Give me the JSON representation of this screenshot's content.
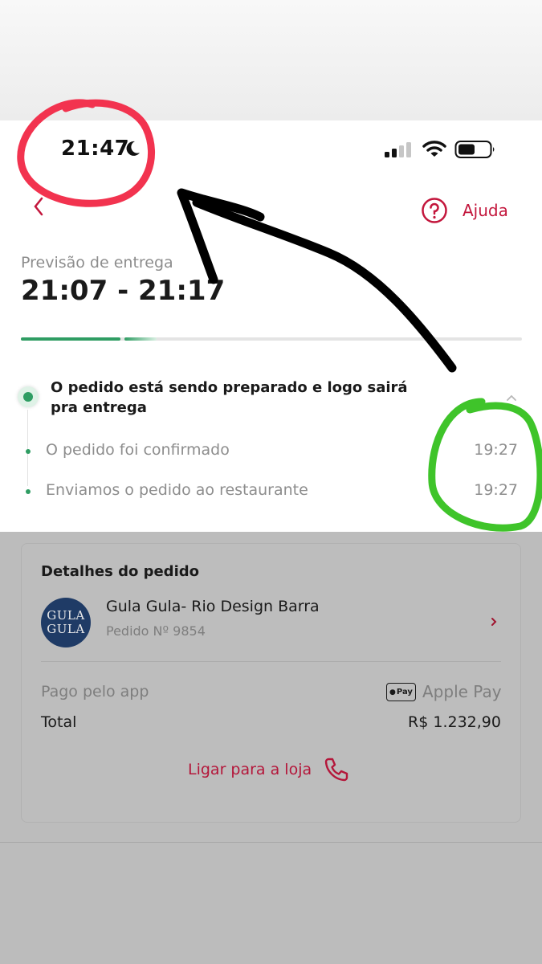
{
  "status_bar": {
    "time": "21:47",
    "icons": [
      "moon-icon",
      "signal-icon",
      "wifi-icon",
      "battery-icon"
    ]
  },
  "header": {
    "back_icon": "chevron-left-icon",
    "help_label": "Ajuda",
    "help_icon": "question-circle-icon"
  },
  "delivery": {
    "eta_label": "Previsão de entrega",
    "eta_range": "21:07 - 21:17",
    "progress_segments_complete": 1,
    "progress_segments_in_progress": 1
  },
  "timeline": {
    "current": "O pedido está sendo preparado e logo sairá pra entrega",
    "steps": [
      {
        "label": "O pedido foi confirmado",
        "time": "19:27"
      },
      {
        "label": "Enviamos o pedido ao restaurante",
        "time": "19:27"
      }
    ]
  },
  "order_details": {
    "title": "Detalhes do pedido",
    "store_logo_line1": "GULA",
    "store_logo_line2": "GULA",
    "store_name": "Gula Gula- Rio Design Barra",
    "order_number": "Pedido Nº 9854",
    "paid_label": "Pago pelo app",
    "applepay_badge": "Pay",
    "paid_method": "Apple Pay",
    "total_label": "Total",
    "total_value": "R$ 1.232,90",
    "call_label": "Ligar para a loja"
  },
  "colors": {
    "accent_red": "#c3163c",
    "progress_green": "#2f9d63",
    "annotation_red": "#f2334f",
    "annotation_green": "#3fc42a",
    "annotation_black": "#000000"
  }
}
